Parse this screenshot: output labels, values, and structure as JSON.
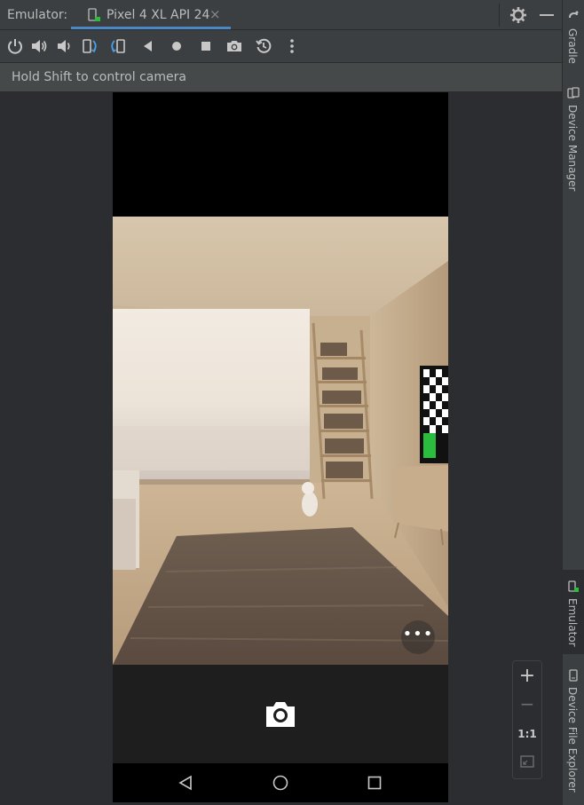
{
  "window": {
    "emulator_label": "Emulator:",
    "tab_label": "Pixel 4 XL API 24",
    "tab_close": "×"
  },
  "toolbar": {
    "icons": [
      "power-icon",
      "volume-up-icon",
      "volume-down-icon",
      "rotate-left-icon",
      "rotate-right-icon",
      "back-icon",
      "home-icon",
      "overview-icon",
      "screenshot-icon",
      "snapshot-icon",
      "more-icon"
    ]
  },
  "hint": {
    "text": "Hold Shift to control camera"
  },
  "device": {
    "more_button": "•••"
  },
  "zoom": {
    "plus": "+",
    "minus": "−",
    "one_to_one": "1:1"
  },
  "right_sidebar": {
    "items": [
      {
        "label": "Gradle"
      },
      {
        "label": "Device Manager"
      },
      {
        "label": "Emulator"
      },
      {
        "label": "Device File Explorer"
      }
    ]
  },
  "colors": {
    "accent": "#4a88c7",
    "panel": "#3c3f41",
    "background": "#2b2d30",
    "status_green": "#2bbd3e"
  }
}
